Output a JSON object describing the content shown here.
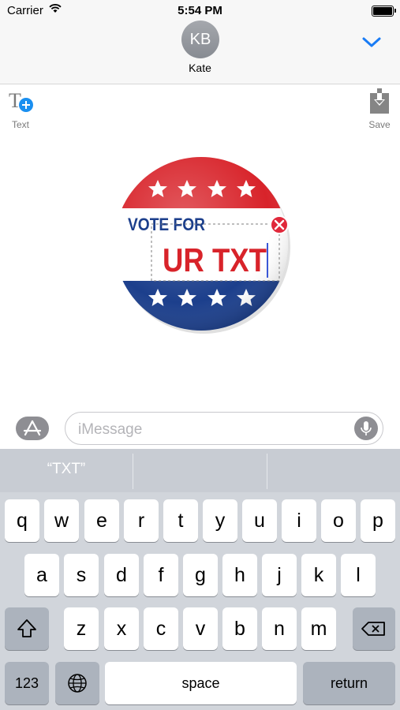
{
  "status_bar": {
    "carrier": "Carrier",
    "time": "5:54 PM",
    "battery_level": 1.0
  },
  "conversation": {
    "contact_initials": "KB",
    "contact_name": "Kate"
  },
  "app_toolbar": {
    "text_label": "Text",
    "save_label": "Save"
  },
  "sticker": {
    "top_text": "VOTE FOR",
    "main_text": "UR TXT",
    "colors": {
      "red": "#d8232a",
      "blue": "#1c3f8c",
      "white": "#ffffff",
      "delete_red": "#e0283a"
    }
  },
  "compose": {
    "placeholder": "iMessage"
  },
  "keyboard": {
    "suggestions": [
      "“TXT”",
      "",
      ""
    ],
    "rows": [
      [
        "q",
        "w",
        "e",
        "r",
        "t",
        "y",
        "u",
        "i",
        "o",
        "p"
      ],
      [
        "a",
        "s",
        "d",
        "f",
        "g",
        "h",
        "j",
        "k",
        "l"
      ],
      [
        "z",
        "x",
        "c",
        "v",
        "b",
        "n",
        "m"
      ]
    ],
    "numbers_label": "123",
    "space_label": "space",
    "return_label": "return"
  },
  "colors": {
    "accent": "#1a7cf5",
    "keyboard_bg": "#d1d5db",
    "key_dark": "#acb3bd"
  }
}
